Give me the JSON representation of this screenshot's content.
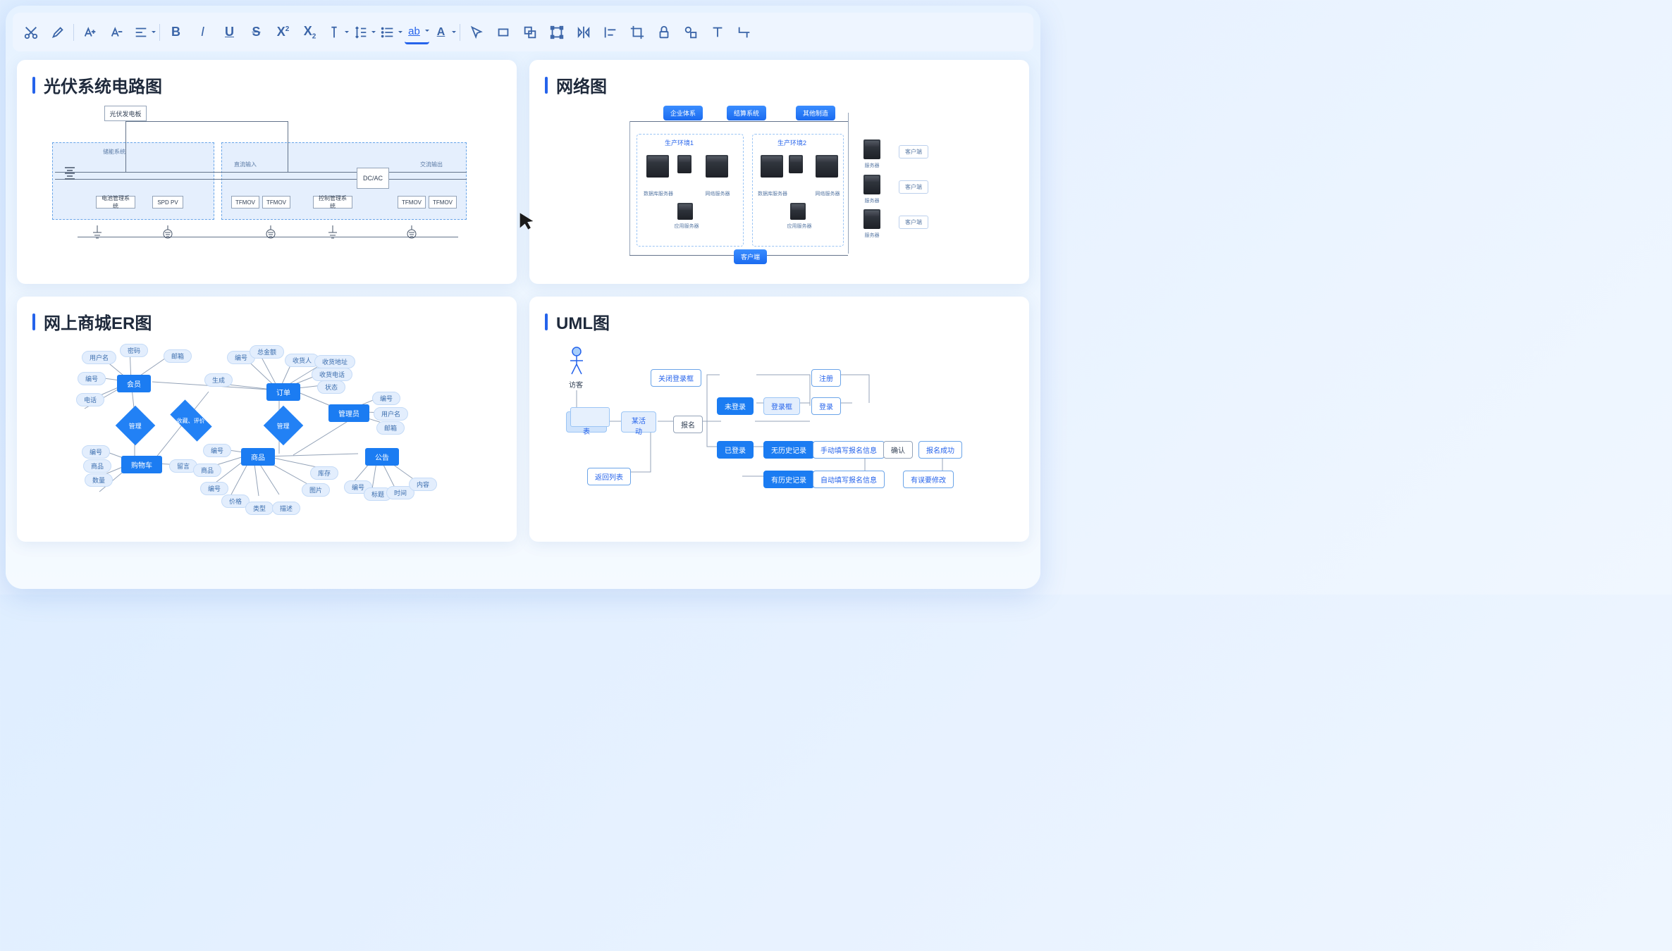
{
  "toolbar": {
    "items": [
      "cut",
      "brush",
      "font-increase",
      "font-decrease",
      "align",
      "bold",
      "italic",
      "underline",
      "strike",
      "superscript",
      "subscript",
      "text-color",
      "line-height",
      "list",
      "text-highlight",
      "font-underline",
      "pointer",
      "rect",
      "group",
      "bbox",
      "flip-h",
      "align-h",
      "crop",
      "lock",
      "shape",
      "text",
      "connector"
    ]
  },
  "cards": {
    "circuit": {
      "title": "光伏系统电路图"
    },
    "network": {
      "title": "网络图"
    },
    "er": {
      "title": "网上商城ER图"
    },
    "uml": {
      "title": "UML图"
    }
  },
  "circuit": {
    "pv": "光伏发电板",
    "storage": "储能系统",
    "dc_in": "直流输入",
    "ac_out": "交流输出",
    "dcac": "DC/AC",
    "bms": "电池管理系统",
    "spd": "SPD PV",
    "tfmov": "TFMOV",
    "ctrl": "控制管理系统"
  },
  "network": {
    "top1": "企业体系",
    "top2": "结算系统",
    "top3": "其他制造",
    "env1": "生产环境1",
    "env2": "生产环境2",
    "db": "数据库服务器",
    "web": "网络服务器",
    "app": "应用服务器",
    "srv": "服务器",
    "client": "客户端",
    "bottom": "客户端"
  },
  "er": {
    "member": "会员",
    "order": "订单",
    "admin": "管理员",
    "cart": "购物车",
    "product": "商品",
    "notice": "公告",
    "manage": "管理",
    "fav": "收藏、评价",
    "uname": "用户名",
    "pwd": "密码",
    "mail": "邮箱",
    "id": "编号",
    "tel": "电话",
    "total": "总金额",
    "recv": "收货人",
    "addr": "收货地址",
    "rtel": "收货电话",
    "create": "生成",
    "state": "状态",
    "aid": "编号",
    "auname": "用户名",
    "amail": "邮箱",
    "cid": "编号",
    "citem": "商品",
    "cqty": "数量",
    "msg": "留言",
    "pid": "编号",
    "pitem": "商品",
    "pprice": "价格",
    "ptype": "类型",
    "pdesc": "描述",
    "pimg": "图片",
    "pstock": "库存",
    "nid": "编号",
    "ntitle": "标题",
    "ncontent": "内容",
    "ntime": "时间"
  },
  "uml": {
    "guest": "访客",
    "list": "活动列表",
    "activity": "某活动",
    "back": "返回列表",
    "close": "关闭登录框",
    "nologin": "未登录",
    "loginbox": "登录框",
    "login": "登录",
    "reg": "注册",
    "signup": "报名",
    "logged": "已登录",
    "nohist": "无历史记录",
    "manual": "手动填写报名信息",
    "confirm": "确认",
    "success": "报名成功",
    "hist": "有历史记录",
    "auto": "自动填写报名信息",
    "modify": "有误要修改"
  }
}
